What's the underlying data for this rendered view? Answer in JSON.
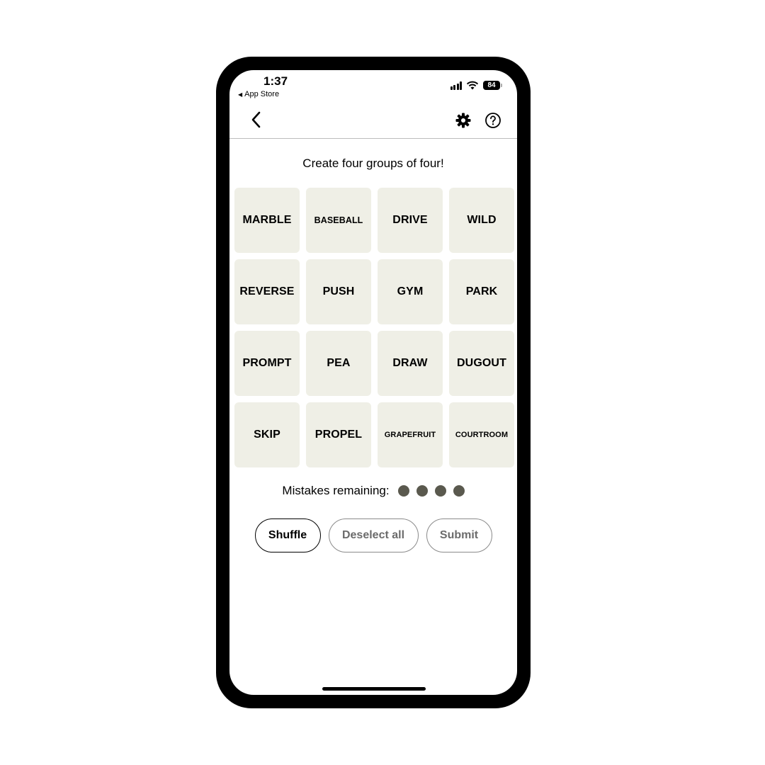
{
  "status_bar": {
    "time": "1:37",
    "back_app": "App Store",
    "battery": "84"
  },
  "nav": {
    "back_icon": "chevron-left-icon",
    "settings_icon": "gear-icon",
    "help_icon": "question-circle-icon"
  },
  "game": {
    "prompt": "Create four groups of four!",
    "tiles": [
      "MARBLE",
      "BASEBALL",
      "DRIVE",
      "WILD",
      "REVERSE",
      "PUSH",
      "GYM",
      "PARK",
      "PROMPT",
      "PEA",
      "DRAW",
      "DUGOUT",
      "SKIP",
      "PROPEL",
      "GRAPEFRUIT",
      "COURTROOM"
    ],
    "mistakes_label": "Mistakes remaining:",
    "mistakes_remaining": 4
  },
  "actions": {
    "shuffle": "Shuffle",
    "deselect_all": "Deselect all",
    "submit": "Submit"
  },
  "colors": {
    "tile_bg": "#efefe6",
    "mistake_dot": "#5a594e"
  }
}
